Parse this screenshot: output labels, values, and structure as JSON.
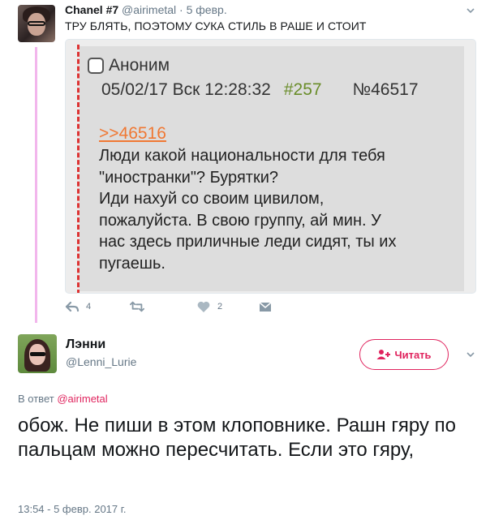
{
  "parent_tweet": {
    "author_name": "Chanel #7",
    "author_handle": "@airimetal",
    "separator": "·",
    "date": "5 февр.",
    "text": "ТРУ БЛЯТЬ, ПОЭТОМУ СУКА СТИЛЬ В РАШЕ И СТОИТ",
    "media": {
      "poster": "Аноним",
      "datetime": "05/02/17 Вск 12:28:32",
      "post_num": "#257",
      "post_id": "№46517",
      "reply_link": ">>46516",
      "body": "Люди какой национальности для тебя\n\"иностранки\"? Бурятки?\nИди нахуй со своим цивилом,\nпожалуйста. В свою группу, ай мин. У\nнас здесь приличные леди сидят, ты их\nпугаешь."
    },
    "actions": {
      "reply_count": "4",
      "like_count": "2"
    }
  },
  "reply_tweet": {
    "author_name": "Лэнни",
    "author_handle": "@Lenni_Lurie",
    "follow_label": "Читать",
    "reply_prefix": "В ответ",
    "reply_mention": "@airimetal",
    "text": "обож. Не пиши в этом клоповнике. Рашн гяру по пальцам можно пересчитать. Если это гяру,",
    "timestamp": "13:54 - 5 февр. 2017 г."
  },
  "colors": {
    "accent": "#e0245e",
    "thread_line": "#f2b6ec",
    "muted": "#657786",
    "post_number": "#6a8d2a",
    "reply_link": "#f07833"
  },
  "icons": [
    "chevron-down-icon",
    "reply-icon",
    "retweet-icon",
    "heart-icon",
    "dm-icon",
    "follow-icon"
  ]
}
